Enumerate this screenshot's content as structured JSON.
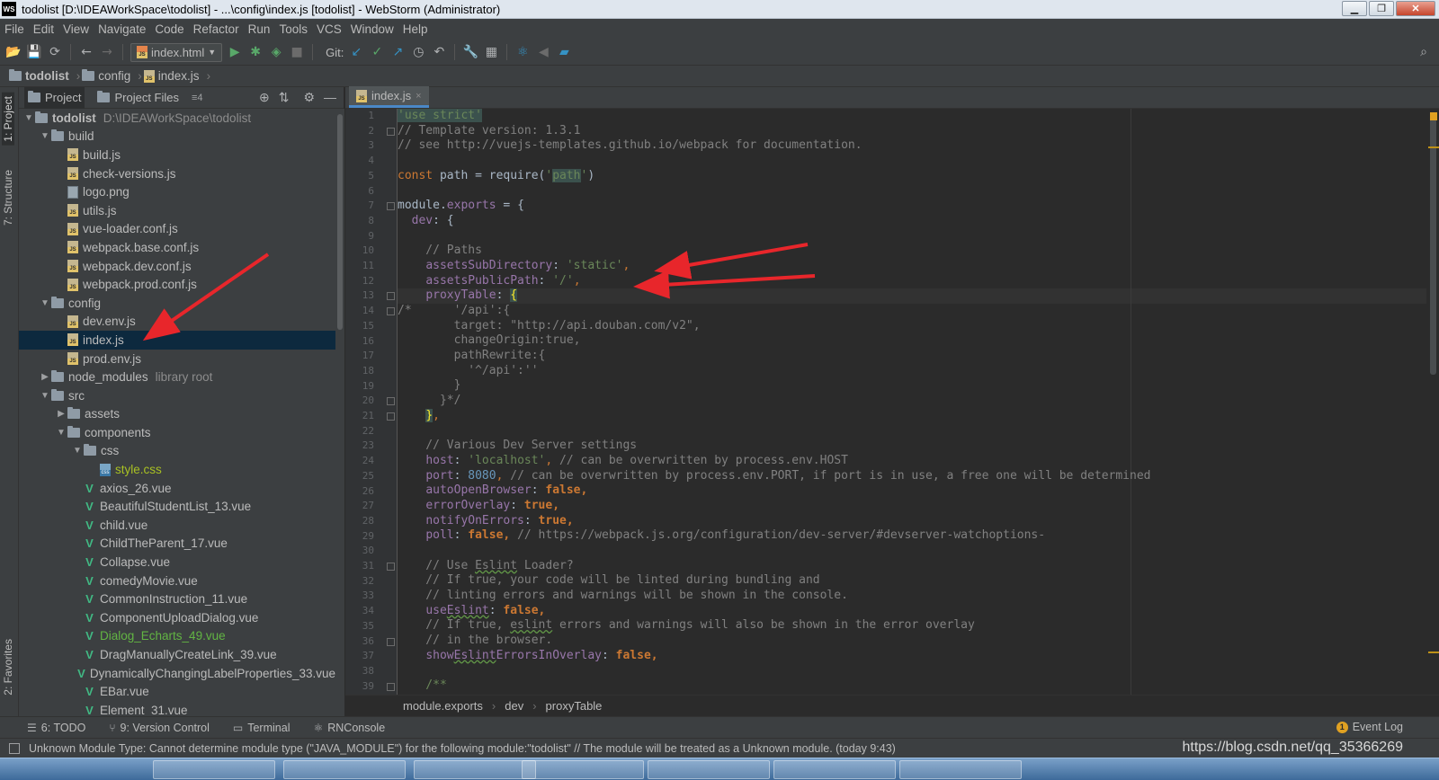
{
  "window": {
    "title": "todolist [D:\\IDEAWorkSpace\\todolist] - ...\\config\\index.js [todolist] - WebStorm (Administrator)",
    "logo_text": "WS",
    "minimize": "▁",
    "maximize": "❐",
    "close": "✕"
  },
  "menu": [
    "File",
    "Edit",
    "View",
    "Navigate",
    "Code",
    "Refactor",
    "Run",
    "Tools",
    "VCS",
    "Window",
    "Help"
  ],
  "toolbar": {
    "run_config": "index.html",
    "git_label": "Git:"
  },
  "breadcrumb": {
    "project": "todolist",
    "folder": "config",
    "file": "index.js"
  },
  "side_tabs": {
    "project": "1: Project",
    "structure": "7: Structure",
    "favorites": "2: Favorites"
  },
  "project_panel": {
    "tab_project": "Project",
    "tab_files": "Project Files",
    "tab_more": "≡4"
  },
  "tree": [
    {
      "level": 0,
      "type": "folder",
      "arrow": "▼",
      "name": "todolist",
      "bold": true,
      "path": "D:\\IDEAWorkSpace\\todolist"
    },
    {
      "level": 1,
      "type": "folder",
      "arrow": "▼",
      "name": "build"
    },
    {
      "level": 2,
      "type": "js",
      "name": "build.js"
    },
    {
      "level": 2,
      "type": "js",
      "name": "check-versions.js"
    },
    {
      "level": 2,
      "type": "img",
      "name": "logo.png"
    },
    {
      "level": 2,
      "type": "js",
      "name": "utils.js"
    },
    {
      "level": 2,
      "type": "js",
      "name": "vue-loader.conf.js"
    },
    {
      "level": 2,
      "type": "js",
      "name": "webpack.base.conf.js"
    },
    {
      "level": 2,
      "type": "js",
      "name": "webpack.dev.conf.js"
    },
    {
      "level": 2,
      "type": "js",
      "name": "webpack.prod.conf.js"
    },
    {
      "level": 1,
      "type": "folder",
      "arrow": "▼",
      "name": "config"
    },
    {
      "level": 2,
      "type": "js",
      "name": "dev.env.js"
    },
    {
      "level": 2,
      "type": "js",
      "name": "index.js",
      "selected": true
    },
    {
      "level": 2,
      "type": "js",
      "name": "prod.env.js"
    },
    {
      "level": 1,
      "type": "folder",
      "arrow": "▶",
      "name": "node_modules",
      "hint": "library root"
    },
    {
      "level": 1,
      "type": "folder",
      "arrow": "▼",
      "name": "src"
    },
    {
      "level": 2,
      "type": "folder",
      "arrow": "▶",
      "name": "assets"
    },
    {
      "level": 2,
      "type": "folder",
      "arrow": "▼",
      "name": "components"
    },
    {
      "level": 3,
      "type": "folder",
      "arrow": "▼",
      "name": "css"
    },
    {
      "level": 4,
      "type": "css",
      "name": "style.css",
      "color": "yellow"
    },
    {
      "level": 3,
      "type": "vue",
      "name": "axios_26.vue"
    },
    {
      "level": 3,
      "type": "vue",
      "name": "BeautifulStudentList_13.vue"
    },
    {
      "level": 3,
      "type": "vue",
      "name": "child.vue"
    },
    {
      "level": 3,
      "type": "vue",
      "name": "ChildTheParent_17.vue"
    },
    {
      "level": 3,
      "type": "vue",
      "name": "Collapse.vue"
    },
    {
      "level": 3,
      "type": "vue",
      "name": "comedyMovie.vue"
    },
    {
      "level": 3,
      "type": "vue",
      "name": "CommonInstruction_11.vue"
    },
    {
      "level": 3,
      "type": "vue",
      "name": "ComponentUploadDialog.vue"
    },
    {
      "level": 3,
      "type": "vue",
      "name": "Dialog_Echarts_49.vue",
      "color": "green"
    },
    {
      "level": 3,
      "type": "vue",
      "name": "DragManuallyCreateLink_39.vue"
    },
    {
      "level": 3,
      "type": "vue",
      "name": "DynamicallyChangingLabelProperties_33.vue"
    },
    {
      "level": 3,
      "type": "vue",
      "name": "EBar.vue"
    },
    {
      "level": 3,
      "type": "vue",
      "name": "Element_31.vue"
    }
  ],
  "editor": {
    "tab_label": "index.js",
    "tab_close": "×",
    "line_numbers": [
      "1",
      "2",
      "3",
      "4",
      "5",
      "6",
      "7",
      "8",
      "9",
      "10",
      "11",
      "12",
      "13",
      "14",
      "15",
      "16",
      "17",
      "18",
      "19",
      "20",
      "21",
      "22",
      "23",
      "24",
      "25",
      "26",
      "27",
      "28",
      "29",
      "30",
      "31",
      "32",
      "33",
      "34",
      "35",
      "36",
      "37",
      "38",
      "39"
    ],
    "lines": [
      [
        {
          "t": "'use strict'",
          "c": "str-hl"
        }
      ],
      [
        {
          "t": "// Template version: 1.3.1",
          "c": "com"
        }
      ],
      [
        {
          "t": "// see http://vuejs-templates.github.io/webpack for documentation.",
          "c": "com"
        }
      ],
      [],
      [
        {
          "t": "const ",
          "c": "kw"
        },
        {
          "t": "path = require("
        },
        {
          "t": "'",
          "c": "str"
        },
        {
          "t": "path",
          "c": "str-hl"
        },
        {
          "t": "'",
          "c": "str"
        },
        {
          "t": ")"
        }
      ],
      [],
      [
        {
          "t": "module."
        },
        {
          "t": "exports",
          "c": "prop"
        },
        {
          "t": " = {"
        }
      ],
      [
        {
          "t": "  "
        },
        {
          "t": "dev",
          "c": "prop"
        },
        {
          "t": ": {"
        }
      ],
      [],
      [
        {
          "t": "    // Paths",
          "c": "com"
        }
      ],
      [
        {
          "t": "    "
        },
        {
          "t": "assetsSubDirectory",
          "c": "prop"
        },
        {
          "t": ": "
        },
        {
          "t": "'static'",
          "c": "str"
        },
        {
          "t": ",",
          "c": "kw"
        }
      ],
      [
        {
          "t": "    "
        },
        {
          "t": "assetsPublicPath",
          "c": "prop"
        },
        {
          "t": ": "
        },
        {
          "t": "'/'",
          "c": "str"
        },
        {
          "t": ",",
          "c": "kw"
        }
      ],
      [
        {
          "t": "    "
        },
        {
          "t": "proxyTable",
          "c": "prop"
        },
        {
          "t": ": "
        },
        {
          "t": "{",
          "c": "brace-hl"
        }
      ],
      [
        {
          "t": "/*      '/api':{",
          "c": "blk-com"
        }
      ],
      [
        {
          "t": "        target: \"http://api.douban.com/v2\",",
          "c": "blk-com"
        }
      ],
      [
        {
          "t": "        changeOrigin:true,",
          "c": "blk-com"
        }
      ],
      [
        {
          "t": "        pathRewrite:{",
          "c": "blk-com"
        }
      ],
      [
        {
          "t": "          '^/api':''",
          "c": "blk-com"
        }
      ],
      [
        {
          "t": "        }",
          "c": "blk-com"
        }
      ],
      [
        {
          "t": "      }*/",
          "c": "blk-com"
        }
      ],
      [
        {
          "t": "    "
        },
        {
          "t": "}",
          "c": "brace-hl"
        },
        {
          "t": ",",
          "c": "kw"
        }
      ],
      [],
      [
        {
          "t": "    // Various Dev Server settings",
          "c": "com"
        }
      ],
      [
        {
          "t": "    "
        },
        {
          "t": "host",
          "c": "prop"
        },
        {
          "t": ": "
        },
        {
          "t": "'localhost'",
          "c": "str"
        },
        {
          "t": ", ",
          "c": "kw"
        },
        {
          "t": "// can be overwritten by process.env.HOST",
          "c": "com"
        }
      ],
      [
        {
          "t": "    "
        },
        {
          "t": "port",
          "c": "prop"
        },
        {
          "t": ": "
        },
        {
          "t": "8080",
          "c": "num"
        },
        {
          "t": ", ",
          "c": "kw"
        },
        {
          "t": "// can be overwritten by process.env.PORT, if port is in use, a free one will be determined",
          "c": "com"
        }
      ],
      [
        {
          "t": "    "
        },
        {
          "t": "autoOpenBrowser",
          "c": "prop"
        },
        {
          "t": ": "
        },
        {
          "t": "false,",
          "c": "kwb"
        }
      ],
      [
        {
          "t": "    "
        },
        {
          "t": "errorOverlay",
          "c": "prop"
        },
        {
          "t": ": "
        },
        {
          "t": "true,",
          "c": "kwb"
        }
      ],
      [
        {
          "t": "    "
        },
        {
          "t": "notifyOnErrors",
          "c": "prop"
        },
        {
          "t": ": "
        },
        {
          "t": "true,",
          "c": "kwb"
        }
      ],
      [
        {
          "t": "    "
        },
        {
          "t": "poll",
          "c": "prop"
        },
        {
          "t": ": "
        },
        {
          "t": "false, ",
          "c": "kwb"
        },
        {
          "t": "// https://webpack.js.org/configuration/dev-server/#devserver-watchoptions-",
          "c": "com"
        }
      ],
      [],
      [
        {
          "t": "    // Use ",
          "c": "com"
        },
        {
          "t": "Eslint",
          "c": "com squig"
        },
        {
          "t": " Loader?",
          "c": "com"
        }
      ],
      [
        {
          "t": "    // If true, your code will be linted during bundling and",
          "c": "com"
        }
      ],
      [
        {
          "t": "    // linting errors and warnings will be shown in the console.",
          "c": "com"
        }
      ],
      [
        {
          "t": "    "
        },
        {
          "t": "use",
          "c": "prop"
        },
        {
          "t": "Eslint",
          "c": "prop squig"
        },
        {
          "t": ": "
        },
        {
          "t": "false,",
          "c": "kwb"
        }
      ],
      [
        {
          "t": "    // If true, ",
          "c": "com"
        },
        {
          "t": "eslint",
          "c": "com squig"
        },
        {
          "t": " errors and warnings will also be shown in the error overlay",
          "c": "com"
        }
      ],
      [
        {
          "t": "    // in the browser.",
          "c": "com"
        }
      ],
      [
        {
          "t": "    "
        },
        {
          "t": "show",
          "c": "prop"
        },
        {
          "t": "Eslint",
          "c": "prop squig"
        },
        {
          "t": "ErrorsInOverlay",
          "c": "prop"
        },
        {
          "t": ": "
        },
        {
          "t": "false,",
          "c": "kwb"
        }
      ],
      [],
      [
        {
          "t": "    /**",
          "c": "str"
        }
      ]
    ],
    "status_path": [
      "module.exports",
      "dev",
      "proxyTable"
    ]
  },
  "bottom_tabs": [
    {
      "icon": "☰",
      "label": "6: TODO"
    },
    {
      "icon": "⑂",
      "label": "9: Version Control"
    },
    {
      "icon": "▭",
      "label": "Terminal"
    },
    {
      "icon": "⚛",
      "label": "RNConsole"
    }
  ],
  "event_log": "Event Log",
  "event_count": "1",
  "status_message": "Unknown Module Type: Cannot determine module type (\"JAVA_MODULE\") for the following module:\"todolist\" // The module will be treated as a Unknown module. (today 9:43)",
  "watermark": "https://blog.csdn.net/qq_35366269",
  "colors": {
    "selection": "#0d293e",
    "annotation_arrow": "#e8262b"
  }
}
